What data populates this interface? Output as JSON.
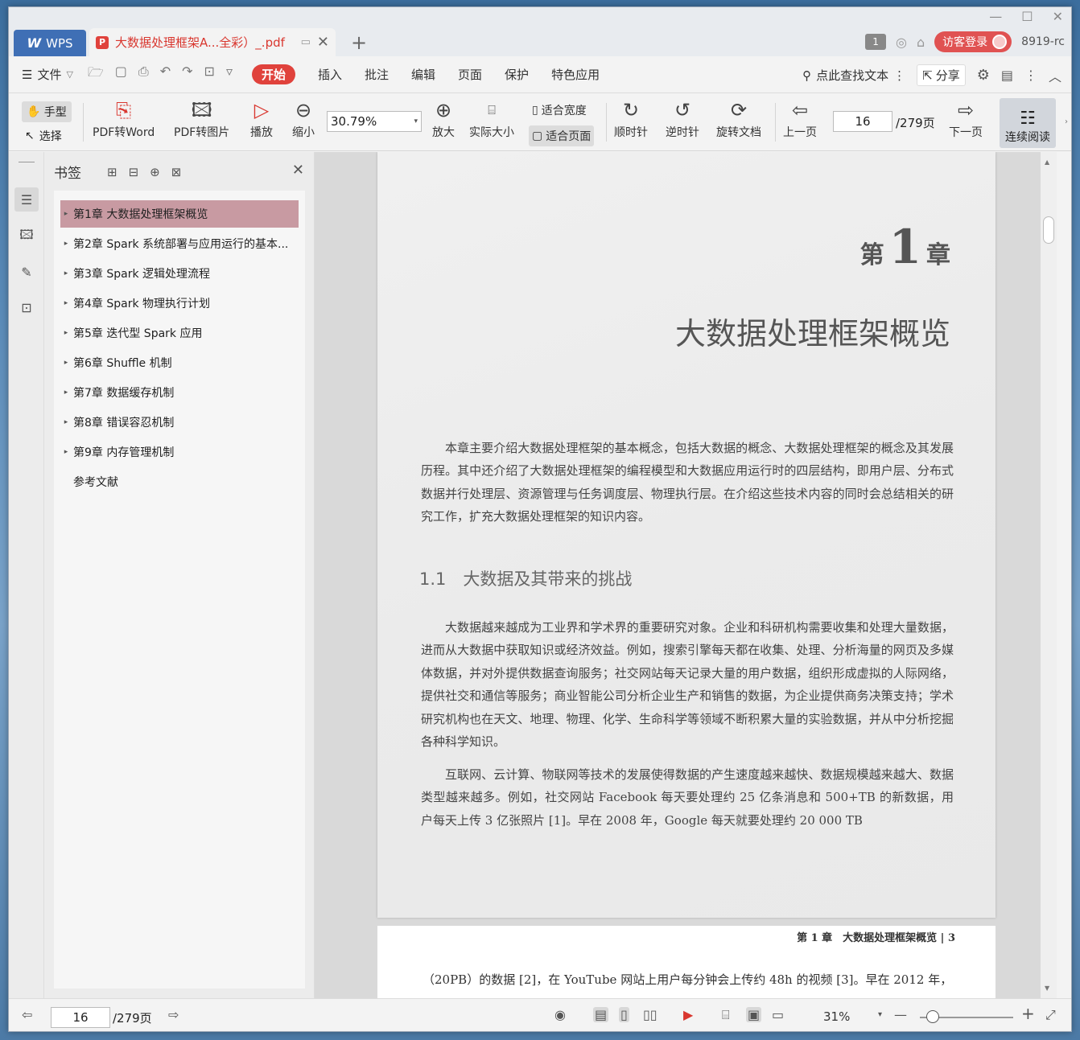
{
  "titlebar": {
    "app_tab": "WPS",
    "doc_tab": "大数据处理框架A...全彩）_.pdf",
    "user_badge": "1",
    "guest_login": "访客登录",
    "user_name": "8919-rc"
  },
  "menubar": {
    "file": "文件",
    "items": [
      "开始",
      "插入",
      "批注",
      "编辑",
      "页面",
      "保护",
      "特色应用"
    ],
    "active_item": "开始",
    "search": "点此查找文本",
    "share": "分享"
  },
  "toolbar": {
    "hand": "手型",
    "select": "选择",
    "pdf_to_word": "PDF转Word",
    "pdf_to_image": "PDF转图片",
    "play": "播放",
    "zoom_out": "缩小",
    "zoom_value": "30.79%",
    "zoom_in": "放大",
    "actual_size": "实际大小",
    "fit_width": "适合宽度",
    "fit_page": "适合页面",
    "clockwise": "顺时针",
    "counter_clockwise": "逆时针",
    "rotate_doc": "旋转文档",
    "prev_page": "上一页",
    "current_page": "16",
    "total_pages": "/279页",
    "next_page": "下一页",
    "continuous": "连续阅读"
  },
  "bookmarks": {
    "title": "书签",
    "items": [
      {
        "label": "第1章 大数据处理框架概览",
        "has_children": true,
        "active": true
      },
      {
        "label": "第2章 Spark 系统部署与应用运行的基本...",
        "has_children": true
      },
      {
        "label": "第3章 Spark 逻辑处理流程",
        "has_children": true
      },
      {
        "label": "第4章 Spark 物理执行计划",
        "has_children": true
      },
      {
        "label": "第5章 迭代型 Spark 应用",
        "has_children": true
      },
      {
        "label": "第6章 Shuffle 机制",
        "has_children": true
      },
      {
        "label": "第7章 数据缓存机制",
        "has_children": true
      },
      {
        "label": "第8章 错误容忍机制",
        "has_children": true
      },
      {
        "label": "第9章 内存管理机制",
        "has_children": true
      },
      {
        "label": "参考文献",
        "has_children": false
      }
    ]
  },
  "document": {
    "chapter_prefix": "第",
    "chapter_number": "1",
    "chapter_suffix": "章",
    "chapter_title": "大数据处理框架概览",
    "intro": "本章主要介绍大数据处理框架的基本概念，包括大数据的概念、大数据处理框架的概念及其发展历程。其中还介绍了大数据处理框架的编程模型和大数据应用运行时的四层结构，即用户层、分布式数据并行处理层、资源管理与任务调度层、物理执行层。在介绍这些技术内容的同时会总结相关的研究工作，扩充大数据处理框架的知识内容。",
    "section_title": "1.1　大数据及其带来的挑战",
    "para1": "大数据越来越成为工业界和学术界的重要研究对象。企业和科研机构需要收集和处理大量数据，进而从大数据中获取知识或经济效益。例如，搜索引擎每天都在收集、处理、分析海量的网页及多媒体数据，并对外提供数据查询服务；社交网站每天记录大量的用户数据，组织形成虚拟的人际网络，提供社交和通信等服务；商业智能公司分析企业生产和销售的数据，为企业提供商务决策支持；学术研究机构也在天文、地理、物理、化学、生命科学等领域不断积累大量的实验数据，并从中分析挖掘各种科学知识。",
    "para2": "互联网、云计算、物联网等技术的发展使得数据的产生速度越来越快、数据规模越来越大、数据类型越来越多。例如，社交网站 Facebook 每天要处理约 25 亿条消息和 500+TB 的新数据，用户每天上传 3 亿张照片 [1]。早在 2008 年，Google 每天就要处理约 20 000 TB",
    "page2_header": "第 1 章　大数据处理框架概览 | 3",
    "page2_text": "（20PB）的数据 [2]，在 YouTube 网站上用户每分钟会上传约 48h 的视频 [3]。早在 2012 年，"
  },
  "statusbar": {
    "current_page": "16",
    "total_pages": "/279页",
    "zoom": "31%"
  }
}
